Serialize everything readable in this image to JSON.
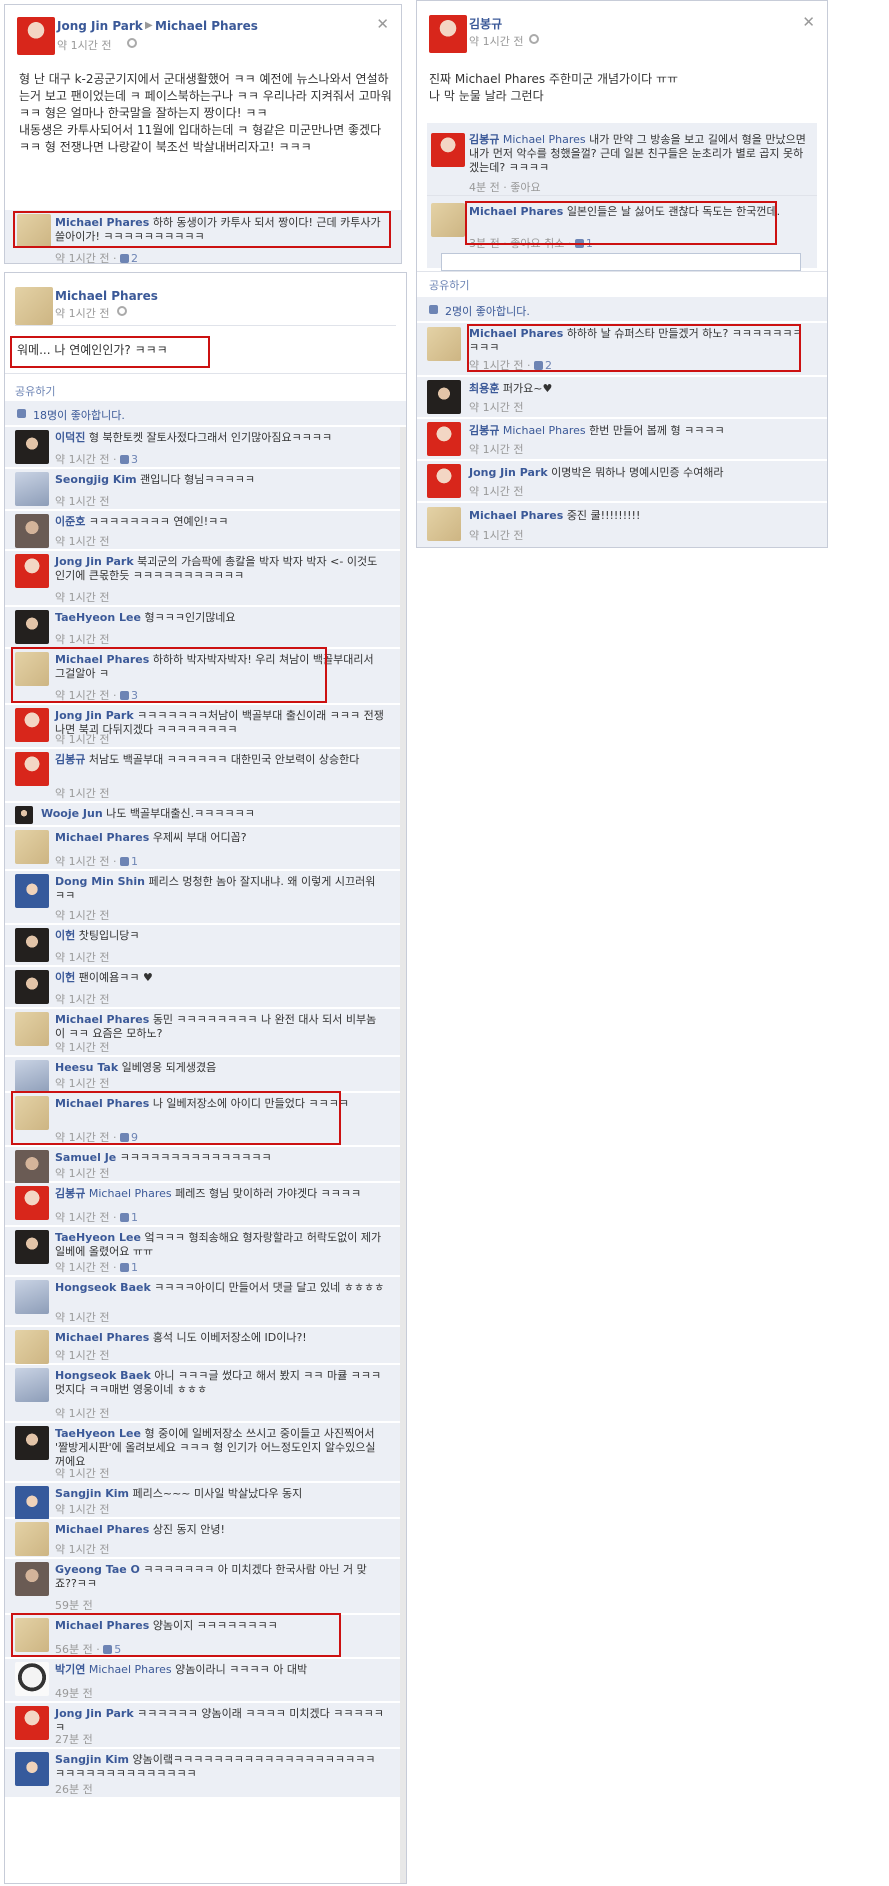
{
  "panel_a": {
    "author": "Jong Jin Park",
    "target": "Michael Phares",
    "time": "약 1시간 전",
    "post_text": "형 난 대구 k-2공군기지에서 군대생활했어 ㅋㅋ 예전에 뉴스나와서 연설하는거 보고 팬이었는데 ㅋ 페이스북하는구나 ㅋㅋ 우리나라 지켜줘서 고마워 ㅋㅋ 형은 얼마나 한국말을 잘하는지 짱이다! ㅋㅋ\n내동생은 카투사되어서 11월에 입대하는데 ㅋ 형같은 미군만나면 좋겠다 ㅋㅋ 형 전쟁나면 나랑같이 북조선 박살내버리자고! ㅋㅋㅋ",
    "comment": {
      "name": "Michael Phares",
      "text": "하하 동생이가 카투사 되서 짱이다! 근데 카투사가 쓸아이가! ㅋㅋㅋㅋㅋㅋㅋㅋㅋㅋ",
      "time": "약 1시간 전",
      "likes": "2"
    }
  },
  "panel_b": {
    "author": "Michael Phares",
    "time": "약 1시간 전",
    "post_text": "워메... 나 연예인인가? ㅋㅋㅋ",
    "share": "공유하기",
    "like_count": "18명이 좋아합니다.",
    "comments": [
      {
        "name": "이덕진",
        "text": "형 북한토켓 잘토사젔다그래서 인기많아짐요ㅋㅋㅋㅋ",
        "time": "약 1시간 전",
        "likes": "3"
      },
      {
        "name": "Seongjig Kim",
        "text": "괜입니다 형님ㅋㅋㅋㅋㅋ",
        "time": "약 1시간 전"
      },
      {
        "name": "이준호",
        "text": "ㅋㅋㅋㅋㅋㅋㅋㅋ 연예인!ㅋㅋ",
        "time": "약 1시간 전"
      },
      {
        "name": "Jong Jin Park",
        "text": "북괴군의 가슴팍에 총칼을 박자 박자 박자 <- 이것도 인기에 큰몫한듯 ㅋㅋㅋㅋㅋㅋㅋㅋㅋㅋㅋ",
        "time": "약 1시간 전"
      },
      {
        "name": "TaeHyeon Lee",
        "text": "형ㅋㅋㅋ인기많네요",
        "time": "약 1시간 전"
      },
      {
        "name": "Michael Phares",
        "text": "하하하 박자박자박자! 우리 쳐남이 백골부대리서 그걸알아 ㅋ",
        "time": "약 1시간 전",
        "likes": "3"
      },
      {
        "name": "Jong Jin Park",
        "text": "ㅋㅋㅋㅋㅋㅋㅋ처남이 백골부대 출신이래 ㅋㅋㅋ 전쟁나면 북괴 다뒤지겠다 ㅋㅋㅋㅋㅋㅋㅋㅋ",
        "time": "약 1시간 전"
      },
      {
        "name": "김봉규",
        "text": "처남도 백골부대 ㅋㅋㅋㅋㅋㅋ 대한민국 안보력이 상승한다",
        "time": "약 1시간 전"
      },
      {
        "name": "Wooje Jun",
        "text": "나도 백골부대출신.ㅋㅋㅋㅋㅋㅋ",
        "time": ""
      },
      {
        "name": "Michael Phares",
        "text": "우제씨 부대 어디꼽?",
        "time": "약 1시간 전",
        "likes": "1"
      },
      {
        "name": "Dong Min Shin",
        "text": "페리스 멍청한 놈아 잘지내냐. 왜 이렇게 시끄러워ㅋㅋ",
        "time": "약 1시간 전"
      },
      {
        "name": "이헌",
        "text": "찻팅입니당ㅋ",
        "time": "약 1시간 전"
      },
      {
        "name": "이헌",
        "text": "팬이예욤ㅋㅋ ♥",
        "time": "약 1시간 전"
      },
      {
        "name": "Michael Phares",
        "text": "동민 ㅋㅋㅋㅋㅋㅋㅋㅋ 나 완전 대사 되서 비부놈이 ㅋㅋ 요즘은 모하노?",
        "time": "약 1시간 전"
      },
      {
        "name": "Heesu Tak",
        "text": "일베영웅 되게생겼음",
        "time": "약 1시간 전"
      },
      {
        "name": "Michael Phares",
        "text": "나 일베저장소에 아이디 만들었다 ㅋㅋㅋㅋ",
        "time": "약 1시간 전",
        "likes": "9"
      },
      {
        "name": "Samuel Je",
        "text": "ㅋㅋㅋㅋㅋㅋㅋㅋㅋㅋㅋㅋㅋㅋㅋ",
        "time": "약 1시간 전"
      },
      {
        "name": "김봉규",
        "mention": "Michael Phares",
        "text": " 페레즈 형님 맞이하러 가야겟다 ㅋㅋㅋㅋ",
        "time": "약 1시간 전",
        "likes": "1"
      },
      {
        "name": "TaeHyeon Lee",
        "text": "엌ㅋㅋㅋ 형죄송해요 형자랑할라고 허락도없이 제가 일베에 올렸어요 ㅠㅠ",
        "time": "약 1시간 전",
        "likes": "1"
      },
      {
        "name": "Hongseok Baek",
        "text": "ㅋㅋㅋㅋ아이디 만들어서 댓글 달고 있네 ㅎㅎㅎㅎ",
        "time": "약 1시간 전"
      },
      {
        "name": "Michael Phares",
        "text": "홍석 니도 이베저장소에 ID이나?!",
        "time": "약 1시간 전"
      },
      {
        "name": "Hongseok Baek",
        "text": "아니 ㅋㅋㅋ글 썼다고 해서 봤지 ㅋㅋ 마큘 ㅋㅋㅋ멋지다 ㅋㅋ매번 영웅이네 ㅎㅎㅎ",
        "time": "약 1시간 전"
      },
      {
        "name": "TaeHyeon Lee",
        "text": "형 중이에 일베저장소 쓰시고 중이들고 사진찍어서 '짤방게시판'에 올려보세요 ㅋㅋㅋ 형 인기가 어느정도인지 알수있으실꺼에요",
        "time": "약 1시간 전"
      },
      {
        "name": "Sangjin Kim",
        "text": "페리스~~~ 미사일 박살났다우 동지",
        "time": "약 1시간 전"
      },
      {
        "name": "Michael Phares",
        "text": "상진 동지 안녕!",
        "time": "약 1시간 전"
      },
      {
        "name": "Gyeong Tae O",
        "text": "ㅋㅋㅋㅋㅋㅋㅋ 아 미치겠다 한국사람 아닌 거 맞죠??ㅋㅋ",
        "time": "59분 전"
      },
      {
        "name": "Michael Phares",
        "text": "양놈이지 ㅋㅋㅋㅋㅋㅋㅋㅋ",
        "time": "56분 전",
        "likes": "5"
      },
      {
        "name": "박기연",
        "mention": "Michael Phares",
        "text": " 양놈이라니 ㅋㅋㅋㅋ 아 대박",
        "time": "49분 전"
      },
      {
        "name": "Jong Jin Park",
        "text": "ㅋㅋㅋㅋㅋㅋ 양놈이래 ㅋㅋㅋㅋ 미치겠다 ㅋㅋㅋㅋㅋㅋ",
        "time": "27분 전"
      },
      {
        "name": "Sangjin Kim",
        "text": "양놈이랰ㅋㅋㅋㅋㅋㅋㅋㅋㅋㅋㅋㅋㅋㅋㅋㅋㅋㅋㅋㅋㅋㅋㅋㅋㅋㅋㅋㅋㅋㅋㅋㅋㅋㅋ",
        "time": "26분 전"
      }
    ]
  },
  "panel_c": {
    "author": "김봉규",
    "time": "약 1시간 전",
    "post_text": "진짜 Michael Phares 주한미군 개념가이다 ㅠㅠ\n나 막 눈물 날라 그런다",
    "comments": [
      {
        "name": "김봉규",
        "mention": "Michael Phares",
        "text": " 내가 만약 그 방송을 보고 길에서 형을 만났으면 내가 먼저 악수를 청했을껄? 근데 일본 친구들은 눈초리가 별로 곱지 못하겠는데? ㅋㅋㅋㅋ",
        "time": "4분 전 · 좋아요"
      },
      {
        "name": "Michael Phares",
        "text": "일본인들은 날 싫어도 괜찮다 독도는 한국껀데.",
        "time": "3분 전 · 좋아요 취소 ·",
        "likes": "1"
      }
    ],
    "share": "공유하기",
    "like_count": "2명이 좋아합니다.",
    "comments2": [
      {
        "name": "Michael Phares",
        "text": "하하하 날 슈퍼스타 만들겠거 하노? ㅋㅋㅋㅋㅋㅋㅋㅋㅋㅋ",
        "time": "약 1시간 전",
        "likes": "2"
      },
      {
        "name": "최용훈",
        "text": "퍼가요~♥",
        "time": "약 1시간 전"
      },
      {
        "name": "김봉규",
        "mention": "Michael Phares",
        "text": " 한번 만들어 봅께 형 ㅋㅋㅋㅋ",
        "time": "약 1시간 전"
      },
      {
        "name": "Jong Jin Park",
        "text": "이명박은 뭐하나 명예시민증 수여해라",
        "time": "약 1시간 전"
      },
      {
        "name": "Michael Phares",
        "text": "중진 쿨!!!!!!!!!",
        "time": "약 1시간 전"
      }
    ]
  },
  "icons": {
    "close": "close-icon",
    "arrow": "right-arrow-icon",
    "privacy": "gear-icon",
    "like": "thumbs-up-icon"
  },
  "colors": {
    "link": "#3b5998",
    "highlight": "#cc1111",
    "comment_bg": "#eceff5"
  }
}
